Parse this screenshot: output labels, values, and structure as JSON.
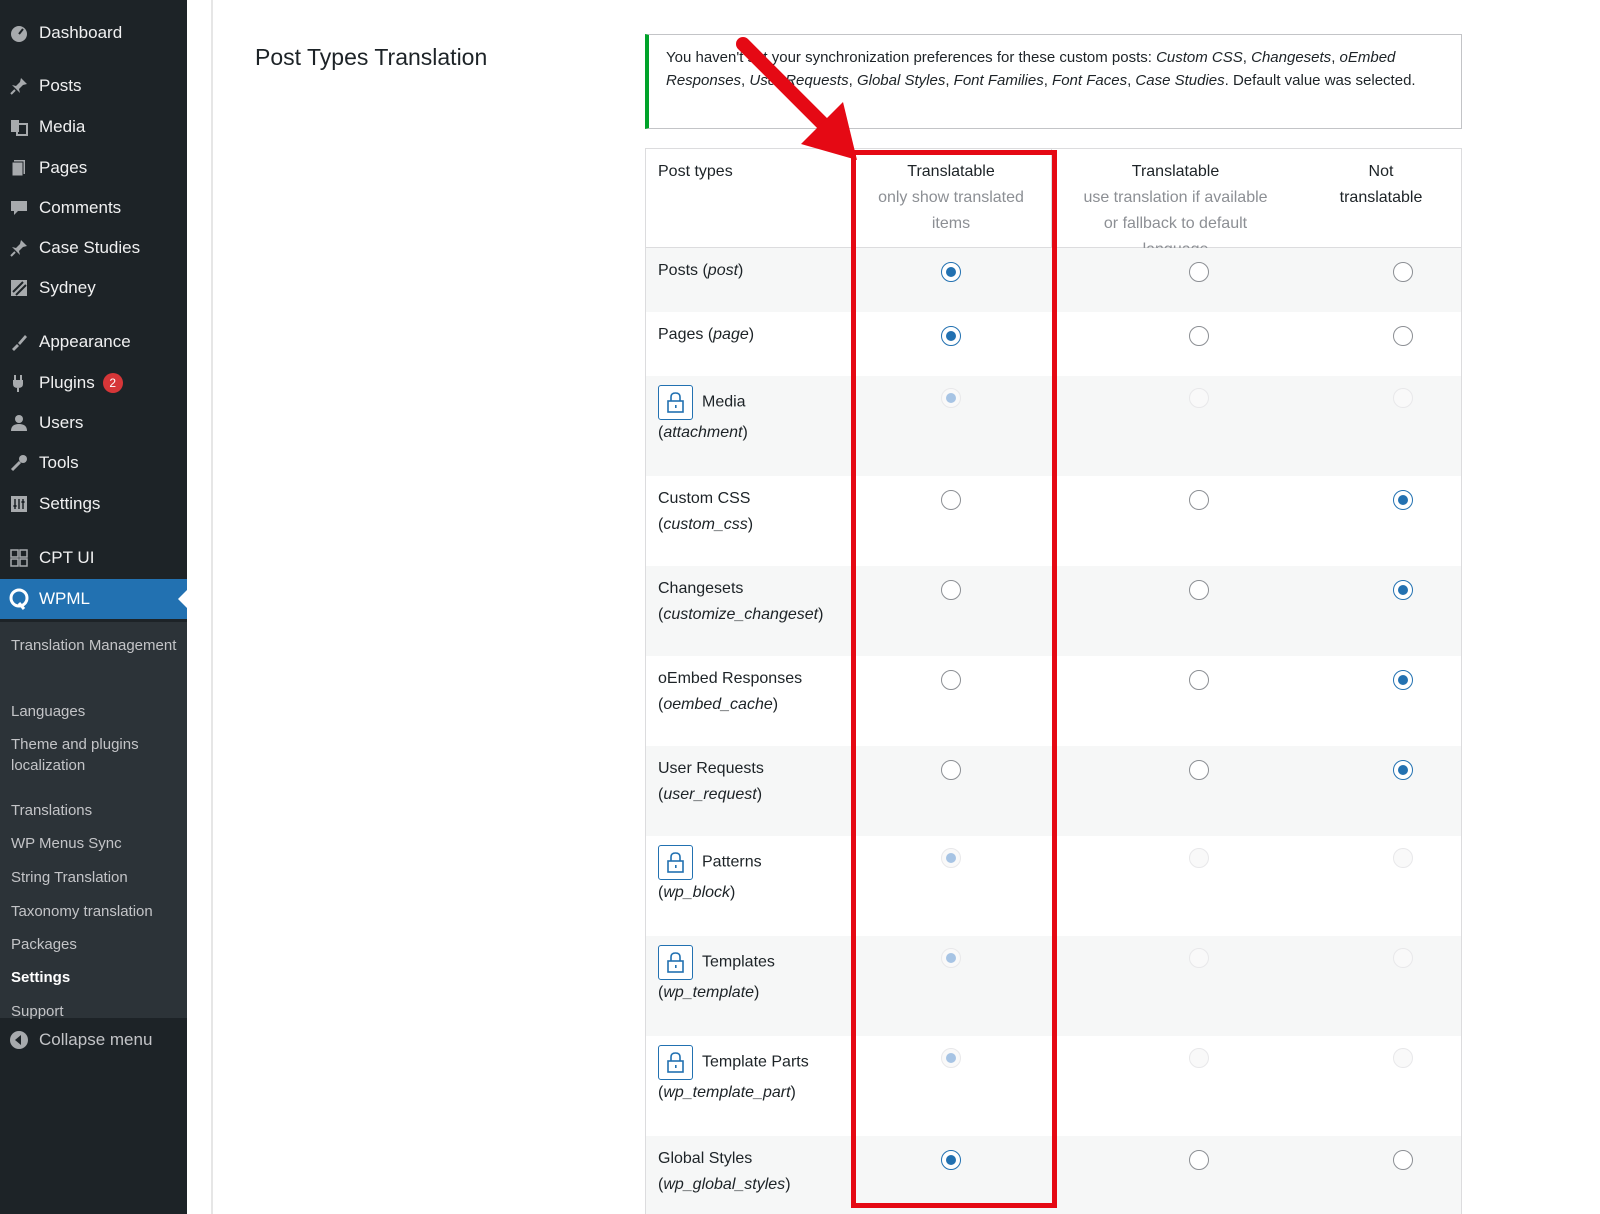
{
  "sidebar": {
    "menu": [
      {
        "label": "Dashboard",
        "icon": "dashboard-icon"
      },
      {
        "label": "Posts",
        "icon": "pin-icon"
      },
      {
        "label": "Media",
        "icon": "media-icon"
      },
      {
        "label": "Pages",
        "icon": "pages-icon"
      },
      {
        "label": "Comments",
        "icon": "comments-icon"
      },
      {
        "label": "Case Studies",
        "icon": "pin-icon"
      },
      {
        "label": "Sydney",
        "icon": "sydney-icon"
      },
      {
        "label": "Appearance",
        "icon": "brush-icon"
      },
      {
        "label": "Plugins",
        "icon": "plugin-icon",
        "badge": "2"
      },
      {
        "label": "Users",
        "icon": "user-icon"
      },
      {
        "label": "Tools",
        "icon": "wrench-icon"
      },
      {
        "label": "Settings",
        "icon": "settings-icon"
      },
      {
        "label": "CPT UI",
        "icon": "grid-icon"
      },
      {
        "label": "WPML",
        "icon": "wpml-icon",
        "active": true
      }
    ],
    "submenu": [
      {
        "label": "Translation Management"
      },
      {
        "label": "Languages"
      },
      {
        "label": "Theme and plugins localization"
      },
      {
        "label": "Translations"
      },
      {
        "label": "WP Menus Sync"
      },
      {
        "label": "String Translation"
      },
      {
        "label": "Taxonomy translation"
      },
      {
        "label": "Packages"
      },
      {
        "label": "Settings",
        "current": true
      },
      {
        "label": "Support"
      }
    ],
    "collapse_label": "Collapse menu"
  },
  "page": {
    "heading": "Post Types Translation"
  },
  "notice": {
    "text_prefix": "You haven't set your synchronization preferences for these custom posts: ",
    "posts": [
      "Custom CSS",
      "Changesets",
      "oEmbed Responses",
      "User Requests",
      "Global Styles",
      "Font Families",
      "Font Faces",
      "Case Studies"
    ],
    "text_suffix": ". Default value was selected."
  },
  "table": {
    "headers": {
      "post_types": "Post types",
      "translatable_only": "Translatable",
      "translatable_only_sub": "only show translated items",
      "translatable_fallback": "Translatable",
      "translatable_fallback_sub": "use translation if available or fallback to default language",
      "not_translatable": "Not translatable"
    },
    "rows": [
      {
        "name": "Posts",
        "slug": "post",
        "locked": false,
        "selected": 0
      },
      {
        "name": "Pages",
        "slug": "page",
        "locked": false,
        "selected": 0
      },
      {
        "name": "Media",
        "slug": "attachment",
        "locked": true,
        "selected": 0
      },
      {
        "name": "Custom CSS",
        "slug": "custom_css",
        "locked": false,
        "selected": 2
      },
      {
        "name": "Changesets",
        "slug": "customize_changeset",
        "locked": false,
        "selected": 2
      },
      {
        "name": "oEmbed Responses",
        "slug": "oembed_cache",
        "locked": false,
        "selected": 2
      },
      {
        "name": "User Requests",
        "slug": "user_request",
        "locked": false,
        "selected": 2
      },
      {
        "name": "Patterns",
        "slug": "wp_block",
        "locked": true,
        "selected": 0
      },
      {
        "name": "Templates",
        "slug": "wp_template",
        "locked": true,
        "selected": 0
      },
      {
        "name": "Template Parts",
        "slug": "wp_template_part",
        "locked": true,
        "selected": 0
      },
      {
        "name": "Global Styles",
        "slug": "wp_global_styles",
        "locked": false,
        "selected": 0
      }
    ]
  },
  "colors": {
    "sidebar_bg": "#1d2327",
    "submenu_bg": "#2c3338",
    "active_blue": "#2271b1",
    "notice_green": "#00a32a",
    "annotation_red": "#e50914"
  }
}
